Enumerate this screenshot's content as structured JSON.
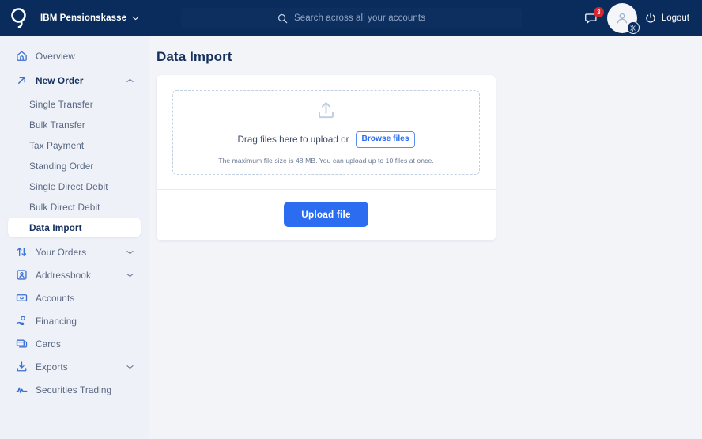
{
  "header": {
    "logo_icon": "brand-q-logo",
    "org_name": "IBM Pensionskasse",
    "org_chevron_icon": "chevron-down-icon",
    "search": {
      "icon": "search-icon",
      "placeholder": "Search across all your accounts",
      "value": ""
    },
    "notifications": {
      "icon": "chat-bubble-icon",
      "badge_count": "3",
      "badge_color": "#d3282f"
    },
    "avatar": {
      "icon": "user-avatar-icon",
      "settings_badge_icon": "gear-icon"
    },
    "logout": {
      "icon": "power-icon",
      "label": "Logout"
    },
    "background_color": "#0a2c5c"
  },
  "sidebar": {
    "background_color": "#eef1f7",
    "items": [
      {
        "label": "Overview",
        "icon": "home-icon",
        "level": "top",
        "expandable": false,
        "active": false,
        "bold": false
      },
      {
        "label": "New Order",
        "icon": "arrow-up-right-icon",
        "level": "top",
        "expandable": true,
        "expanded": true,
        "chevron": "chevron-up-icon",
        "active": false,
        "bold": true
      },
      {
        "label": "Single Transfer",
        "icon": "",
        "level": "sub",
        "expandable": false,
        "active": false,
        "bold": false
      },
      {
        "label": "Bulk Transfer",
        "icon": "",
        "level": "sub",
        "expandable": false,
        "active": false,
        "bold": false
      },
      {
        "label": "Tax Payment",
        "icon": "",
        "level": "sub",
        "expandable": false,
        "active": false,
        "bold": false
      },
      {
        "label": "Standing Order",
        "icon": "",
        "level": "sub",
        "expandable": false,
        "active": false,
        "bold": false
      },
      {
        "label": "Single Direct Debit",
        "icon": "",
        "level": "sub",
        "expandable": false,
        "active": false,
        "bold": false
      },
      {
        "label": "Bulk Direct Debit",
        "icon": "",
        "level": "sub",
        "expandable": false,
        "active": false,
        "bold": false
      },
      {
        "label": "Data Import",
        "icon": "",
        "level": "sub",
        "expandable": false,
        "active": true,
        "bold": true
      },
      {
        "label": "Your Orders",
        "icon": "sort-arrows-icon",
        "level": "top",
        "expandable": true,
        "expanded": false,
        "chevron": "chevron-down-icon",
        "active": false,
        "bold": false
      },
      {
        "label": "Addressbook",
        "icon": "contact-card-icon",
        "level": "top",
        "expandable": true,
        "expanded": false,
        "chevron": "chevron-down-icon",
        "active": false,
        "bold": false
      },
      {
        "label": "Accounts",
        "icon": "banknote-icon",
        "level": "top",
        "expandable": false,
        "active": false,
        "bold": false
      },
      {
        "label": "Financing",
        "icon": "hand-coin-icon",
        "level": "top",
        "expandable": false,
        "active": false,
        "bold": false
      },
      {
        "label": "Cards",
        "icon": "credit-cards-icon",
        "level": "top",
        "expandable": false,
        "active": false,
        "bold": false
      },
      {
        "label": "Exports",
        "icon": "download-tray-icon",
        "level": "top",
        "expandable": true,
        "expanded": false,
        "chevron": "chevron-down-icon",
        "active": false,
        "bold": false
      },
      {
        "label": "Securities Trading",
        "icon": "pulse-line-icon",
        "level": "top",
        "expandable": false,
        "active": false,
        "bold": false
      }
    ]
  },
  "main": {
    "page_title": "Data Import",
    "dropzone": {
      "upload_icon": "upload-tray-icon",
      "text": "Drag files here to upload or",
      "browse_label": "Browse files",
      "hint": "The maximum file size is 48 MB. You can upload up to 10 files at once."
    },
    "footer": {
      "upload_label": "Upload file",
      "accent_color": "#2b6cf0"
    }
  }
}
